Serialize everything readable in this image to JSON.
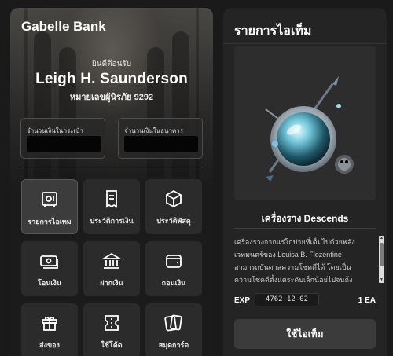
{
  "left": {
    "bank_name": "Gabelle Bank",
    "welcome": "ยินดีต้อนรับ",
    "user_name": "Leigh H. Saunderson",
    "account": "หมายเลขผู้นิรภัย 9292",
    "wallet_label": "จำนวนเงินในกระเป๋า",
    "bank_label": "จำนวนเงินในธนาคาร",
    "menu": [
      {
        "label": "รายการไอเทม",
        "icon": "safe-icon"
      },
      {
        "label": "ประวัติการเงิน",
        "icon": "receipt-icon"
      },
      {
        "label": "ประวัติพัสดุ",
        "icon": "package-icon"
      },
      {
        "label": "โอนเงิน",
        "icon": "banknote-icon"
      },
      {
        "label": "ฝากเงิน",
        "icon": "bank-icon"
      },
      {
        "label": "ถอนเงิน",
        "icon": "wallet-icon"
      },
      {
        "label": "ส่งของ",
        "icon": "gift-icon"
      },
      {
        "label": "ใช้โค้ด",
        "icon": "ticket-icon"
      },
      {
        "label": "สมุดการ์ด",
        "icon": "cards-icon"
      }
    ]
  },
  "right": {
    "title": "รายการไอเท็ม",
    "item_name": "เครื่องราง Descends",
    "description": "เครื่องรางจากแร่โกปายที่เต็มไปด้วยพลังเวทมนตร์ของ Louisa B. Flozentine สามารถบันดาลความโชคดีได้ โดยเป็นความโชคดีตั้งแต่ระดับเล็กน้อยไปจนถึงระดับมาก ขึ้นอยู่กับค่า",
    "exp_label": "EXP",
    "exp_value": "4762-12-02",
    "quantity": "1 EA",
    "use_button": "ใช้ไอเท็ม"
  },
  "colors": {
    "background": "#1a1a1a",
    "panel": "#242424",
    "tile": "#2b2b2b",
    "tile_active": "#3c3c3c",
    "button": "#3b3b3b"
  }
}
